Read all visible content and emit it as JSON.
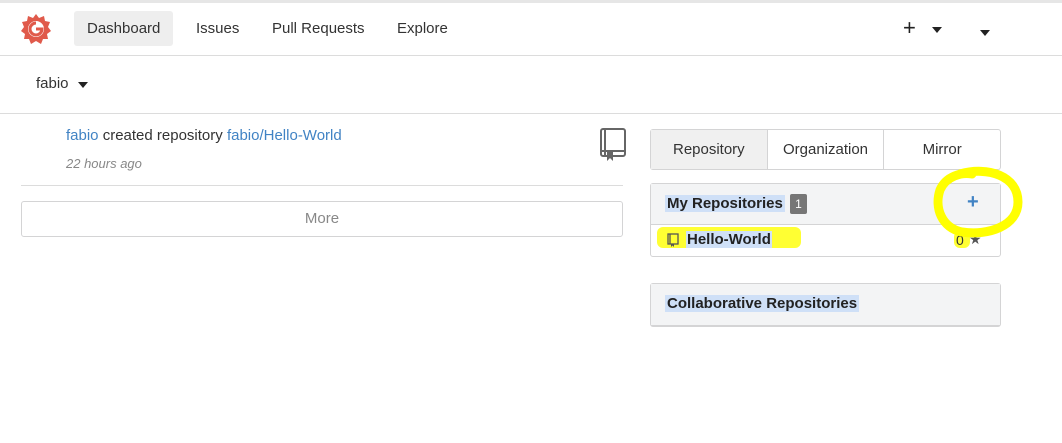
{
  "nav": {
    "logo": "gitea-logo-icon",
    "items": [
      {
        "label": "Dashboard",
        "active": true
      },
      {
        "label": "Issues",
        "active": false
      },
      {
        "label": "Pull Requests",
        "active": false
      },
      {
        "label": "Explore",
        "active": false
      }
    ],
    "plus": "+"
  },
  "context": {
    "user": "fabio"
  },
  "feed": {
    "actor": "fabio",
    "action": "created repository",
    "repo": "fabio/Hello-World",
    "time": "22 hours ago",
    "icon": "book-icon",
    "more_label": "More"
  },
  "tabs": [
    "Repository",
    "Organization",
    "Mirror"
  ],
  "my_repos": {
    "title": "My Repositories",
    "count": "1",
    "add": "+",
    "repos": [
      {
        "name": "Hello-World",
        "stars": "0",
        "star_icon": "★"
      }
    ]
  },
  "collab": {
    "title": "Collaborative Repositories"
  },
  "colors": {
    "accent": "#4183c4",
    "logo": "#e05a4b",
    "highlight": "#ffff00"
  }
}
